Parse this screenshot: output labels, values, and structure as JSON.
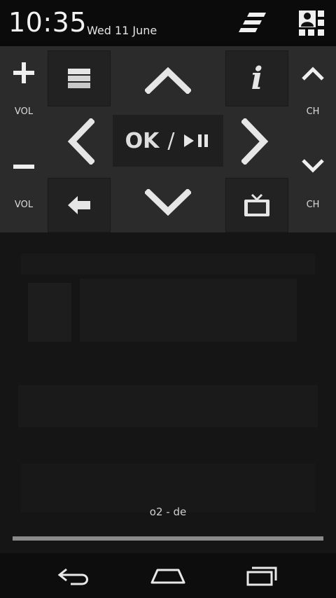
{
  "status_bar": {
    "time": "10:35",
    "date": "Wed 11 June",
    "icons": [
      "quick-settings-icon",
      "user-profile-icon"
    ]
  },
  "remote": {
    "vol_up_label": "VOL",
    "vol_down_label": "VOL",
    "ch_up_label": "CH",
    "ch_down_label": "CH",
    "ok_text": "OK",
    "ok_separator": "/",
    "info_symbol": "i",
    "icons": [
      "plus-icon",
      "minus-icon",
      "menu-icon",
      "info-icon",
      "arrow-up-icon",
      "arrow-down-icon",
      "arrow-left-icon",
      "arrow-right-icon",
      "back-arrow-icon",
      "tv-icon",
      "chevron-up-icon",
      "chevron-down-icon",
      "play-pause-icon"
    ]
  },
  "player": {
    "channel_name": "o2 - de",
    "progress": 1.0
  },
  "navbar": {
    "icons": [
      "back-icon",
      "home-icon",
      "recents-icon"
    ]
  },
  "colors": {
    "panel": "#2b2b2b",
    "key": "#222222",
    "glyph": "#e6e6e6"
  }
}
